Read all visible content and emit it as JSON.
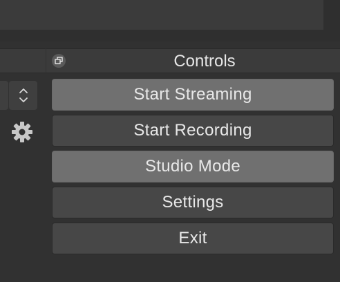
{
  "controls": {
    "title": "Controls",
    "buttons": [
      {
        "label": "Start Streaming",
        "active": true
      },
      {
        "label": "Start Recording",
        "active": false
      },
      {
        "label": "Studio Mode",
        "active": true
      },
      {
        "label": "Settings",
        "active": false
      },
      {
        "label": "Exit",
        "active": false
      }
    ]
  },
  "icons": {
    "float": "float-dock-icon",
    "spin": "up-down-chevrons-icon",
    "gear": "gear-icon"
  },
  "colors": {
    "background": "#313131",
    "button": "#474747",
    "button_active": "#707070",
    "text": "#e8e8e8"
  }
}
